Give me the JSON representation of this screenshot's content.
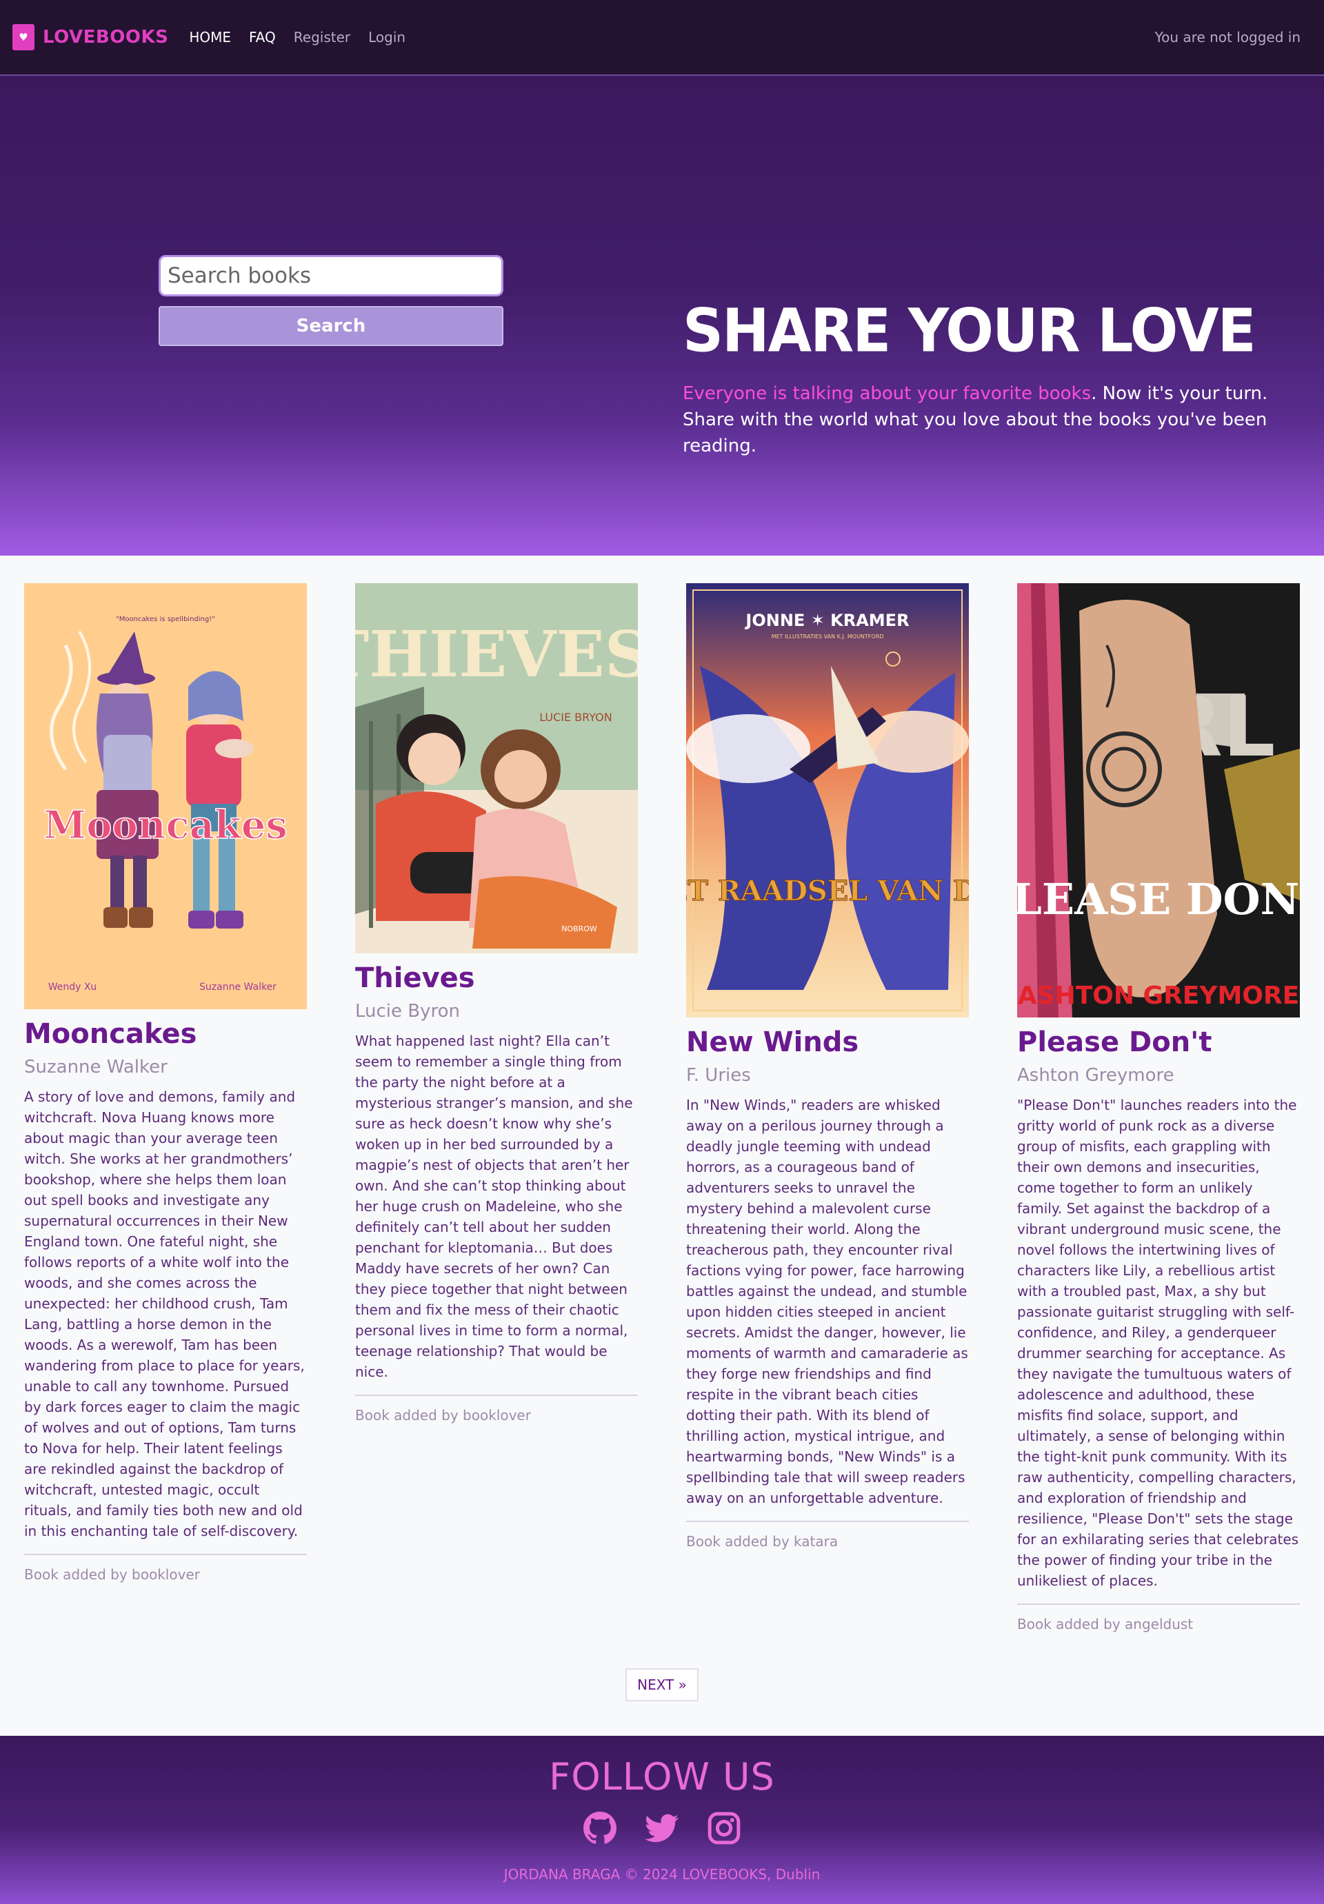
{
  "nav": {
    "brand": "LOVEBOOKS",
    "brand_icon": "heart-book-icon",
    "links": [
      "HOME",
      "FAQ",
      "Register",
      "Login"
    ],
    "status": "You are not logged in"
  },
  "search": {
    "placeholder": "Search books",
    "button": "Search"
  },
  "hero": {
    "title": "SHARE YOUR LOVE",
    "highlight": "Everyone is talking about your favorite books",
    "body": ". Now it's your turn. Share with the world what you love about the books you've been reading."
  },
  "books": [
    {
      "title": "Mooncakes",
      "author": "Suzanne Walker",
      "description": "A story of love and demons, family and witchcraft. Nova Huang knows more about magic than your average teen witch. She works at her grandmothers’ bookshop, where she helps them loan out spell books and investigate any supernatural occurrences in their New England town. One fateful night, she follows reports of a white wolf into the woods, and she comes across the unexpected: her childhood crush, Tam Lang, battling a horse demon in the woods. As a werewolf, Tam has been wandering from place to place for years, unable to call any townhome. Pursued by dark forces eager to claim the magic of wolves and out of options, Tam turns to Nova for help. Their latent feelings are rekindled against the backdrop of witchcraft, untested magic, occult rituals, and family ties both new and old in this enchanting tale of self-discovery.",
      "added_by": "Book added by booklover",
      "cover": {
        "title": "Mooncakes",
        "tagline": "\"Mooncakes is spellbinding!\"",
        "credits": [
          "Wendy Xu",
          "Suzanne Walker"
        ],
        "bg": "#ffce8f"
      }
    },
    {
      "title": "Thieves",
      "author": "Lucie Byron",
      "description": "What happened last night? Ella can’t seem to remember a single thing from the party the night before at a mysterious stranger’s mansion, and she sure as heck doesn’t know why she’s woken up in her bed surrounded by a magpie’s nest of objects that aren’t her own. And she can’t stop thinking about her huge crush on Madeleine, who she definitely can’t tell about her sudden penchant for kleptomania… But does Maddy have secrets of her own? Can they piece together that night between them and fix the mess of their chaotic personal lives in time to form a normal, teenage relationship? That would be nice.",
      "added_by": "Book added by booklover",
      "cover": {
        "title": "THIEVES",
        "credits": [
          "LUCIE BRYON",
          "NOBROW"
        ],
        "bg": "#b6cdb1"
      }
    },
    {
      "title": "New Winds",
      "author": "F. Uries",
      "description": "In \"New Winds,\" readers are whisked away on a perilous journey through a deadly jungle teeming with undead horrors, as a courageous band of adventurers seeks to unravel the mystery behind a malevolent curse threatening their world. Along the treacherous path, they encounter rival factions vying for power, face harrowing battles against the undead, and stumble upon hidden cities steeped in ancient secrets. Amidst the danger, however, lie moments of warmth and camaraderie as they forge new friendships and find respite in the vibrant beach cities dotting their path. With its blend of thrilling action, mystical intrigue, and heartwarming bonds, \"New Winds\" is a spellbinding tale that will sweep readers away on an unforgettable adventure.",
      "added_by": "Book added by katara",
      "cover": {
        "title": "HET RAADSEL VAN DE ZEE",
        "credits": [
          "JONNE ✶ KRAMER",
          "MET ILLUSTRATIES VAN K.J. MOUNTFORD"
        ],
        "bg": "#2d2a7a"
      }
    },
    {
      "title": "Please Don't",
      "author": "Ashton Greymore",
      "description": "\"Please Don't\" launches readers into the gritty world of punk rock as a diverse group of misfits, each grappling with their own demons and insecurities, come together to form an unlikely family. Set against the backdrop of a vibrant underground music scene, the novel follows the intertwining lives of characters like Lily, a rebellious artist with a troubled past, Max, a shy but passionate guitarist struggling with self-confidence, and Riley, a genderqueer drummer searching for acceptance. As they navigate the tumultuous waters of adolescence and adulthood, these misfits find solace, support, and ultimately, a sense of belonging within the tight-knit punk community. With its raw authenticity, compelling characters, and exploration of friendship and resilience, \"Please Don't\" sets the stage for an exhilarating series that celebrates the power of finding your tribe in the unlikeliest of places.",
      "added_by": "Book added by angeldust",
      "cover": {
        "title": "PLEASE DON'T",
        "credits": [
          "ASHTON GREYMORE",
          "RL"
        ],
        "bg": "#1b1a1a"
      }
    }
  ],
  "pagination": {
    "next": "NEXT »"
  },
  "footer": {
    "follow": "FOLLOW US",
    "socials": [
      "github-icon",
      "twitter-icon",
      "instagram-icon"
    ],
    "copyright": "JORDANA BRAGA © 2024 LOVEBOOKS, Dublin"
  }
}
